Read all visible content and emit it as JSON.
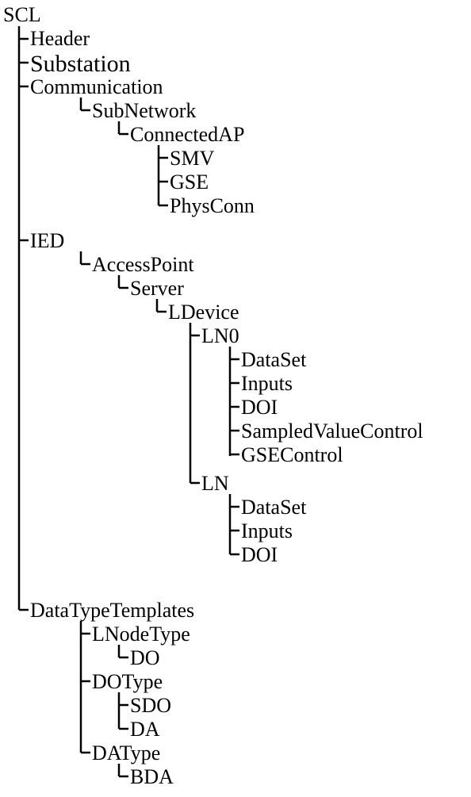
{
  "tree": {
    "root": "SCL",
    "n1": "Header",
    "n2": "Substation",
    "n3": "Communication",
    "n3_1": "SubNetwork",
    "n3_1_1": "ConnectedAP",
    "n3_1_1_1": "SMV",
    "n3_1_1_2": "GSE",
    "n3_1_1_3": "PhysConn",
    "n4": "IED",
    "n4_1": "AccessPoint",
    "n4_1_1": "Server",
    "n4_1_1_1": "LDevice",
    "n4_1_1_1_1": "LN0",
    "n4_1_1_1_1_1": "DataSet",
    "n4_1_1_1_1_2": "Inputs",
    "n4_1_1_1_1_3": "DOI",
    "n4_1_1_1_1_4": "SampledValueControl",
    "n4_1_1_1_1_5": "GSEControl",
    "n4_1_1_1_2": "LN",
    "n4_1_1_1_2_1": "DataSet",
    "n4_1_1_1_2_2": "Inputs",
    "n4_1_1_1_2_3": "DOI",
    "n5": "DataTypeTemplates",
    "n5_1": "LNodeType",
    "n5_1_1": "DO",
    "n5_2": "DOType",
    "n5_2_1": "SDO",
    "n5_2_2": "DA",
    "n5_3": "DAType",
    "n5_3_1": "BDA"
  }
}
